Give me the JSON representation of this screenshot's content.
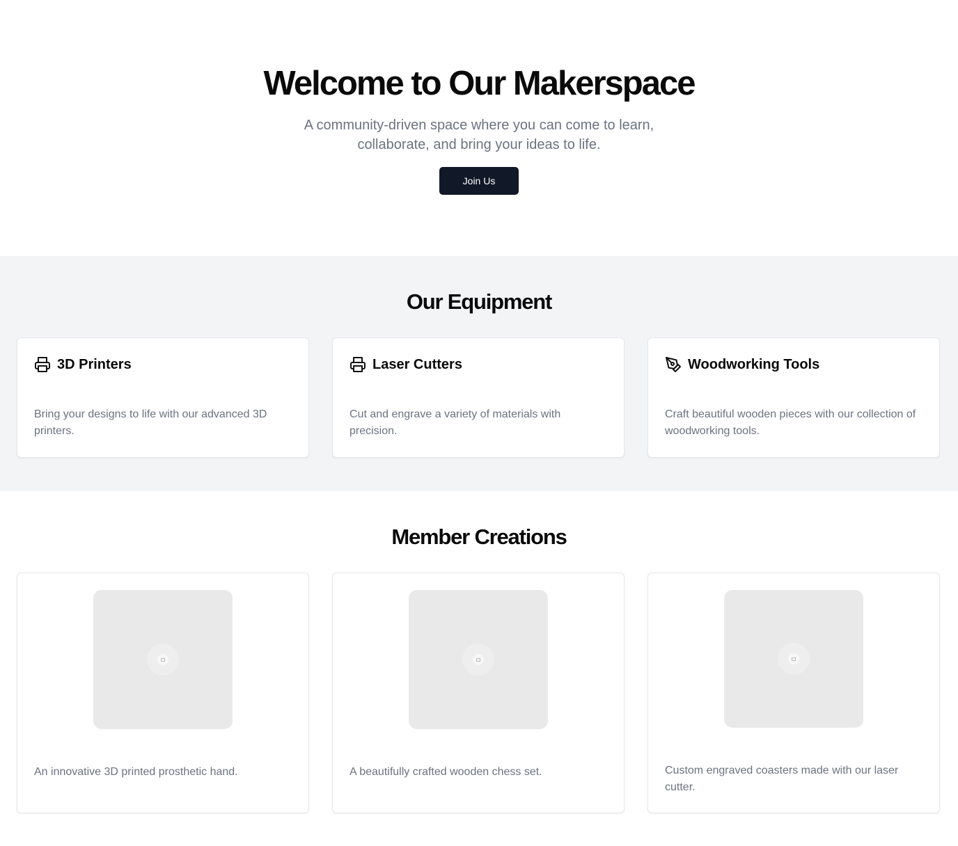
{
  "hero": {
    "title": "Welcome to Our Makerspace",
    "subtitle": "A community-driven space where you can come to learn, collaborate, and bring your ideas to life.",
    "cta_label": "Join Us"
  },
  "equipment": {
    "title": "Our Equipment",
    "items": [
      {
        "icon": "printer-icon",
        "name": "3D Printers",
        "description": "Bring your designs to life with our advanced 3D printers."
      },
      {
        "icon": "printer-icon",
        "name": "Laser Cutters",
        "description": "Cut and engrave a variety of materials with precision."
      },
      {
        "icon": "pen-tool-icon",
        "name": "Woodworking Tools",
        "description": "Craft beautiful wooden pieces with our collection of woodworking tools."
      }
    ]
  },
  "creations": {
    "title": "Member Creations",
    "items": [
      {
        "image": "image-placeholder-icon",
        "description": "An innovative 3D printed prosthetic hand."
      },
      {
        "image": "image-placeholder-icon",
        "description": "A beautifully crafted wooden chess set."
      },
      {
        "image": "image-placeholder-icon",
        "description": "Custom engraved coasters made with our laser cutter."
      }
    ]
  },
  "colors": {
    "button_bg": "#111827",
    "section_bg": "#f3f4f6",
    "muted_text": "#6b7280"
  }
}
